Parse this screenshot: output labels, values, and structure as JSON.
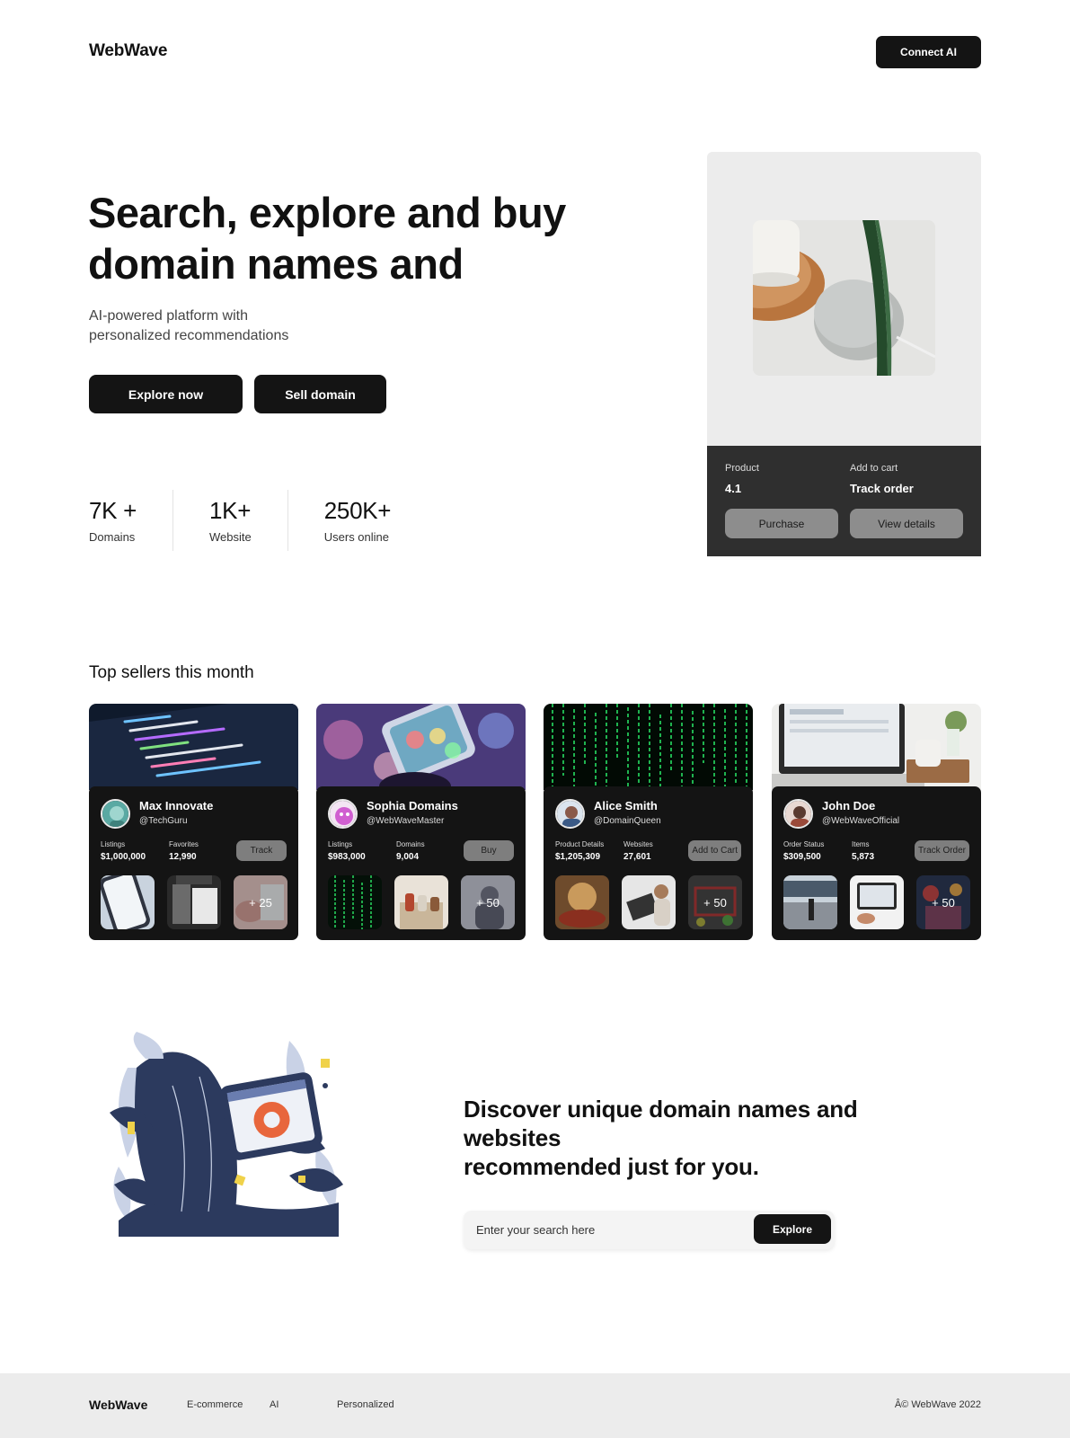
{
  "header": {
    "logo": "WebWave",
    "connect_label": "Connect AI"
  },
  "hero": {
    "title": "Search, explore and buy domain names and",
    "subtitle": "AI-powered platform with personalized recommendations",
    "explore_label": "Explore now",
    "sell_label": "Sell domain"
  },
  "stats": [
    {
      "value": "7K +",
      "label": "Domains"
    },
    {
      "value": "1K+",
      "label": "Website"
    },
    {
      "value": "250K+",
      "label": "Users online"
    }
  ],
  "product_card": {
    "left_label": "Product",
    "left_value": "4.1",
    "right_label": "Add to cart",
    "right_value": "Track order",
    "purchase_label": "Purchase",
    "details_label": "View details"
  },
  "sellers_section": {
    "title": "Top sellers this month"
  },
  "sellers": [
    {
      "name": "Max Innovate",
      "handle": "@TechGuru",
      "stat1_label": "Listings",
      "stat1_value": "$1,000,000",
      "stat2_label": "Favorites",
      "stat2_value": "12,990",
      "button": "Track",
      "more": "+ 25"
    },
    {
      "name": "Sophia Domains",
      "handle": "@WebWaveMaster",
      "stat1_label": "Listings",
      "stat1_value": "$983,000",
      "stat2_label": "Domains",
      "stat2_value": "9,004",
      "button": "Buy",
      "more": "+ 50"
    },
    {
      "name": "Alice Smith",
      "handle": "@DomainQueen",
      "stat1_label": "Product Details",
      "stat1_value": "$1,205,309",
      "stat2_label": "Websites",
      "stat2_value": "27,601",
      "button": "Add to Cart",
      "more": "+ 50"
    },
    {
      "name": "John Doe",
      "handle": "@WebWaveOfficial",
      "stat1_label": "Order Status",
      "stat1_value": "$309,500",
      "stat2_label": "Items",
      "stat2_value": "5,873",
      "button": "Track Order",
      "more": "+ 50"
    }
  ],
  "discover": {
    "title_line1": "Discover unique domain names and",
    "title_line2": "websites",
    "title_line3": "recommended just for you.",
    "search_placeholder": "Enter your search here",
    "explore_label": "Explore"
  },
  "footer": {
    "logo": "WebWave",
    "links": [
      "E-commerce",
      "AI",
      "Personalized"
    ],
    "copyright": "Â© WebWave 2022"
  }
}
